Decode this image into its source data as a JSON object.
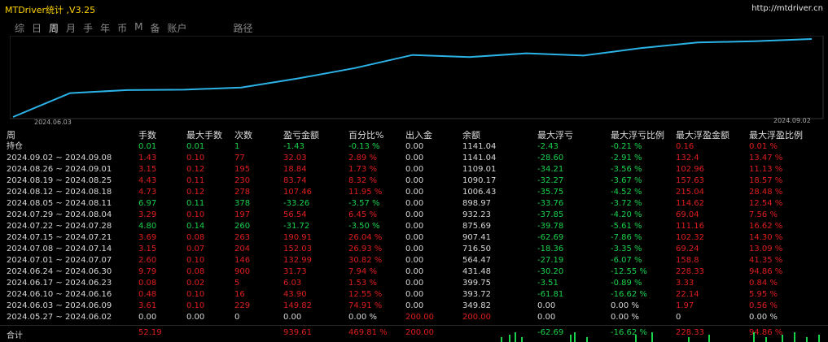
{
  "window": {
    "title": "MTDriver统计 ,V3.25",
    "url": "http://mtdriver.cn"
  },
  "tabs": [
    "综",
    "日",
    "周",
    "月",
    "手",
    "年",
    "币",
    "M",
    "备",
    "账户",
    "路径"
  ],
  "active_tab": "周",
  "chart_data": {
    "type": "line",
    "x_start_label": "2024.06.03",
    "x_end_label": "2024.09.02",
    "color": "#2bb3e8",
    "values": [
      0,
      349.82,
      393.72,
      399.75,
      431.48,
      564.47,
      716.5,
      907.41,
      875.69,
      932.23,
      898.97,
      1006.43,
      1090.17,
      1109.01,
      1141.04
    ]
  },
  "table": {
    "headers": [
      "周",
      "手数",
      "最大手数",
      "次数",
      "盈亏金额",
      "百分比%",
      "出入金",
      "余额",
      "最大浮亏",
      "最大浮亏比例",
      "最大浮盈金额",
      "最大浮盈比例"
    ],
    "position_row": {
      "label": "持仓",
      "c1": "0.01",
      "c2": "0.01",
      "c3": "1",
      "c4": "-1.43",
      "c5": "-0.13 %",
      "c6": "0.00",
      "c7": "1141.04",
      "c8": "-2.43",
      "c9": "-0.21 %",
      "c10": "0.16",
      "c11": "0.01 %"
    },
    "rows": [
      {
        "p": "2024.09.02 ~ 2024.09.08",
        "v": [
          "1.43",
          "0.10",
          "77",
          "32.03",
          "2.89 %",
          "0.00",
          "1141.04",
          "-28.60",
          "-2.91 %",
          "132.4",
          "13.47 %"
        ],
        "col": "red"
      },
      {
        "p": "2024.08.26 ~ 2024.09.01",
        "v": [
          "3.15",
          "0.12",
          "195",
          "18.84",
          "1.73 %",
          "0.00",
          "1109.01",
          "-34.21",
          "-3.56 %",
          "102.96",
          "11.13 %"
        ],
        "col": "red"
      },
      {
        "p": "2024.08.19 ~ 2024.08.25",
        "v": [
          "4.43",
          "0.11",
          "230",
          "83.74",
          "8.32 %",
          "0.00",
          "1090.17",
          "-32.27",
          "-3.67 %",
          "157.63",
          "18.57 %"
        ],
        "col": "red"
      },
      {
        "p": "2024.08.12 ~ 2024.08.18",
        "v": [
          "4.73",
          "0.12",
          "278",
          "107.46",
          "11.95 %",
          "0.00",
          "1006.43",
          "-35.75",
          "-4.52 %",
          "215.04",
          "28.48 %"
        ],
        "col": "red"
      },
      {
        "p": "2024.08.05 ~ 2024.08.11",
        "v": [
          "6.97",
          "0.11",
          "378",
          "-33.26",
          "-3.57 %",
          "0.00",
          "898.97",
          "-33.76",
          "-3.72 %",
          "114.62",
          "12.54 %"
        ],
        "col": "green"
      },
      {
        "p": "2024.07.29 ~ 2024.08.04",
        "v": [
          "3.29",
          "0.10",
          "197",
          "56.54",
          "6.45 %",
          "0.00",
          "932.23",
          "-37.85",
          "-4.20 %",
          "69.04",
          "7.56 %"
        ],
        "col": "red"
      },
      {
        "p": "2024.07.22 ~ 2024.07.28",
        "v": [
          "4.80",
          "0.14",
          "260",
          "-31.72",
          "-3.50 %",
          "0.00",
          "875.69",
          "-39.78",
          "-5.61 %",
          "111.16",
          "16.62 %"
        ],
        "col": "green"
      },
      {
        "p": "2024.07.15 ~ 2024.07.21",
        "v": [
          "3.69",
          "0.08",
          "263",
          "190.91",
          "26.04 %",
          "0.00",
          "907.41",
          "-62.69",
          "-7.86 %",
          "102.32",
          "14.30 %"
        ],
        "col": "red"
      },
      {
        "p": "2024.07.08 ~ 2024.07.14",
        "v": [
          "3.15",
          "0.07",
          "204",
          "152.03",
          "26.93 %",
          "0.00",
          "716.50",
          "-18.36",
          "-3.35 %",
          "69.24",
          "13.09 %"
        ],
        "col": "red"
      },
      {
        "p": "2024.07.01 ~ 2024.07.07",
        "v": [
          "2.60",
          "0.10",
          "146",
          "132.99",
          "30.82 %",
          "0.00",
          "564.47",
          "-27.19",
          "-6.07 %",
          "158.8",
          "41.35 %"
        ],
        "col": "red"
      },
      {
        "p": "2024.06.24 ~ 2024.06.30",
        "v": [
          "9.79",
          "0.08",
          "900",
          "31.73",
          "7.94 %",
          "0.00",
          "431.48",
          "-30.20",
          "-12.55 %",
          "228.33",
          "94.86 %"
        ],
        "col": "red"
      },
      {
        "p": "2024.06.17 ~ 2024.06.23",
        "v": [
          "0.08",
          "0.02",
          "5",
          "6.03",
          "1.53 %",
          "0.00",
          "399.75",
          "-3.51",
          "-0.89 %",
          "3.33",
          "0.84 %"
        ],
        "col": "red"
      },
      {
        "p": "2024.06.10 ~ 2024.06.16",
        "v": [
          "0.48",
          "0.10",
          "16",
          "43.90",
          "12.55 %",
          "0.00",
          "393.72",
          "-61.81",
          "-16.62 %",
          "22.14",
          "5.95 %"
        ],
        "col": "red"
      },
      {
        "p": "2024.06.03 ~ 2024.06.09",
        "v": [
          "3.61",
          "0.10",
          "229",
          "149.82",
          "74.91 %",
          "0.00",
          "349.82",
          "0.00",
          "0.00 %",
          "1.97",
          "0.56 %"
        ],
        "col": "red"
      },
      {
        "p": "2024.05.27 ~ 2024.06.02",
        "v": [
          "0.00",
          "0.00",
          "0",
          "0.00",
          "0.00 %",
          "200.00",
          "200.00",
          "0.00",
          "0.00 %",
          "0",
          "0.00 %"
        ],
        "col": "white"
      }
    ],
    "total": {
      "label": "合计",
      "c1": "52.19",
      "c4": "939.61",
      "c5": "469.81 %",
      "c6": "200.00",
      "c8": "-62.69",
      "c9": "-16.62 %",
      "c10": "228.33",
      "c11": "94.86 %"
    }
  }
}
